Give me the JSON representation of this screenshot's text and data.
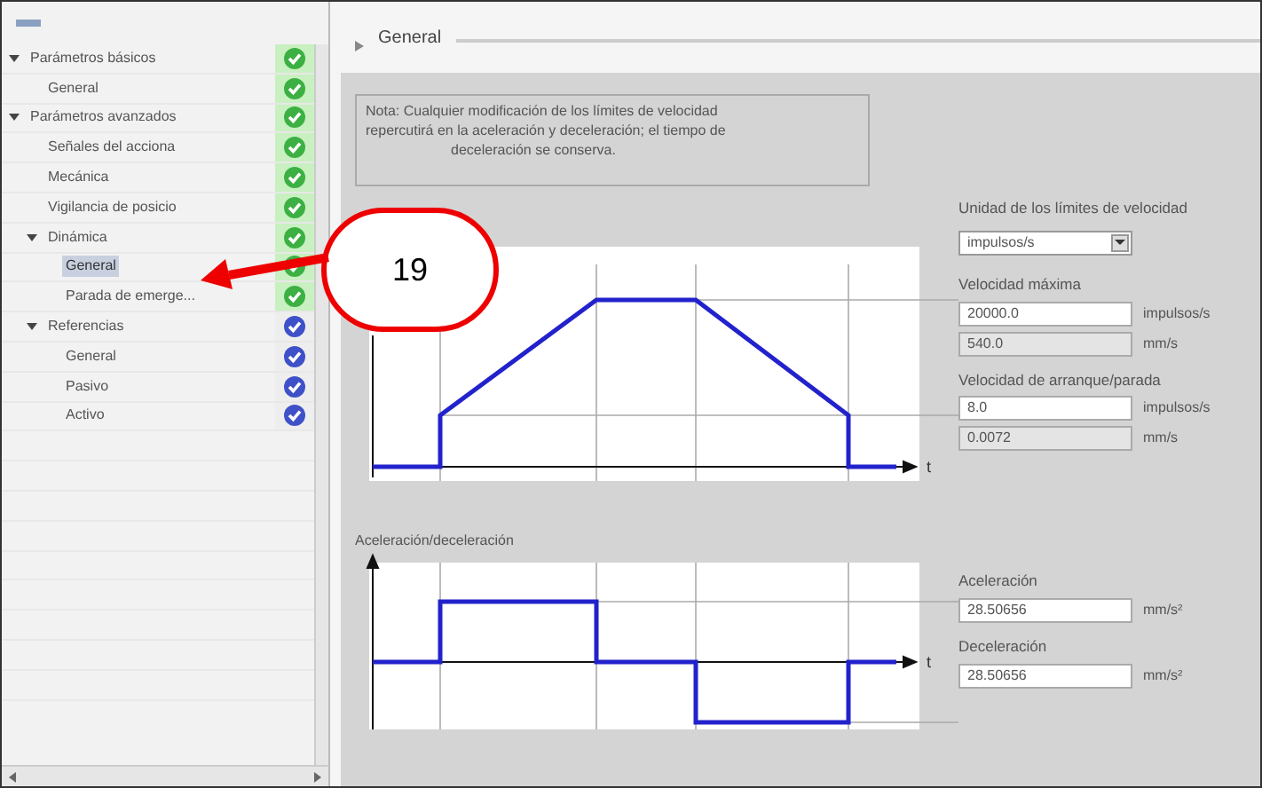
{
  "tree": [
    {
      "label": "Parámetros básicos",
      "expanded": true,
      "color": "#3cb043",
      "children": [
        {
          "label": "General",
          "selected": false,
          "color": "#3cb043"
        }
      ]
    },
    {
      "label": "Parámetros avanzados",
      "expanded": true,
      "color": "#3cb043",
      "children": [
        {
          "label": "Señales del acciona",
          "selected": false,
          "color": "#3cb043"
        },
        {
          "label": "Mecánica",
          "selected": false,
          "color": "#3cb043"
        },
        {
          "label": "Vigilancia de posicio",
          "selected": false,
          "color": "#3cb043"
        },
        {
          "label": "Dinámica",
          "expanded": true,
          "color": "#3cb043",
          "children": [
            {
              "label": "General",
              "selected": true,
              "color": "#3cb043"
            },
            {
              "label": "Parada de emerge...",
              "selected": false,
              "color": "#3cb043"
            }
          ]
        },
        {
          "label": "Referencias",
          "expanded": true,
          "color": "#3f51c8",
          "children": [
            {
              "label": "General",
              "selected": false,
              "color": "#3f51c8"
            },
            {
              "label": "Pasivo",
              "selected": false,
              "color": "#3f51c8"
            },
            {
              "label": "Activo",
              "selected": false,
              "color": "#3f51c8"
            }
          ]
        }
      ]
    }
  ],
  "section": {
    "title": "General"
  },
  "note": [
    "Nota: Cualquier modificación de los límites de velocidad",
    "repercutirá en la aceleración y deceleración; el tiempo de",
    "deceleración se conserva."
  ],
  "unit": {
    "label": "Unidad de los límites de velocidad",
    "value": "impulsos/s"
  },
  "speed_fields": [
    {
      "kind": "heading",
      "text": "Velocidad máxima"
    },
    {
      "kind": "field",
      "value": "20000.0",
      "unit": "impulsos/s",
      "editable": true
    },
    {
      "kind": "field",
      "value": "540.0",
      "unit": "mm/s",
      "editable": false
    },
    {
      "kind": "heading",
      "text": "Velocidad de arranque/parada"
    },
    {
      "kind": "field",
      "value": "8.0",
      "unit": "impulsos/s",
      "editable": true
    },
    {
      "kind": "field",
      "value": "0.0072",
      "unit": "mm/s",
      "editable": false
    }
  ],
  "velocity_chart": {
    "axis_label": "t"
  },
  "accel_chart": {
    "title": "Aceleración/deceleración",
    "axis_label": "t"
  },
  "accel_fields": [
    {
      "kind": "heading",
      "text": "Aceleración"
    },
    {
      "kind": "field",
      "value": "28.50656",
      "unit": "mm/s²",
      "editable": true
    },
    {
      "kind": "heading",
      "text": "Deceleración"
    },
    {
      "kind": "field",
      "value": "28.50656",
      "unit": "mm/s²",
      "editable": true
    }
  ],
  "callout": {
    "label": "19"
  }
}
